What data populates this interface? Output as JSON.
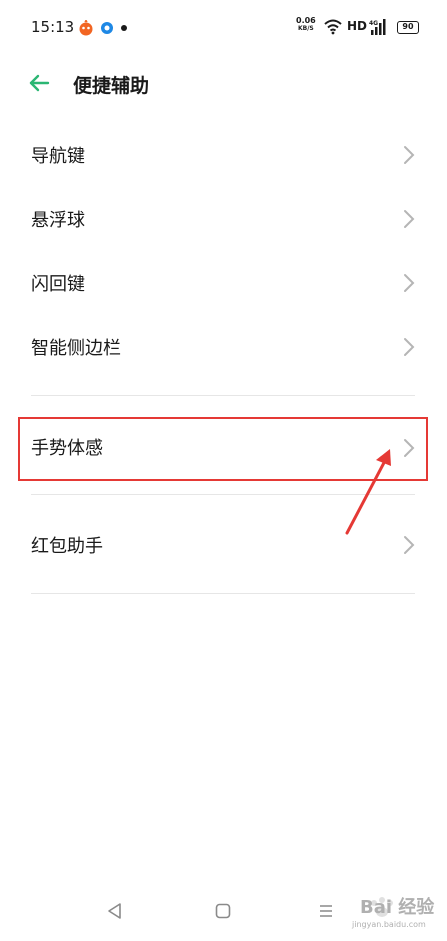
{
  "status_bar": {
    "time": "15:13",
    "net_speed_value": "0.06",
    "net_speed_unit": "KB/S",
    "hd": "HD",
    "signal_label": "4G",
    "battery": "90"
  },
  "header": {
    "title": "便捷辅助"
  },
  "menu": {
    "group1": [
      {
        "label": "导航键"
      },
      {
        "label": "悬浮球"
      },
      {
        "label": "闪回键"
      },
      {
        "label": "智能侧边栏"
      }
    ],
    "group2": [
      {
        "label": "手势体感"
      }
    ],
    "group3": [
      {
        "label": "红包助手"
      }
    ]
  },
  "annotation": {
    "highlight_color": "#e53935",
    "highlighted_item": "手势体感"
  },
  "watermark": {
    "brand": "Bai 经验",
    "url": "jingyan.baidu.com"
  },
  "colors": {
    "accent": "#2bb673",
    "text": "#1a1a1a",
    "chevron": "#b5b5b5",
    "divider": "#e6e6e6"
  }
}
